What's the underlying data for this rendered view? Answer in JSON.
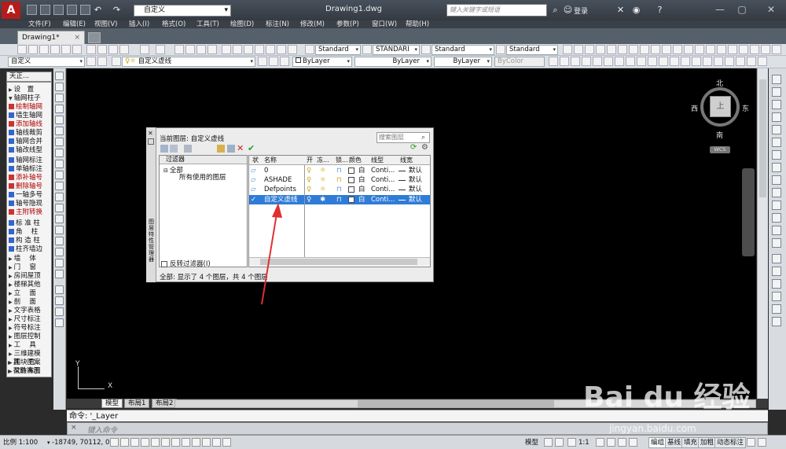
{
  "app": {
    "logo_letter": "A",
    "workspace": "自定义",
    "title": "Drawing1.dwg",
    "search_placeholder": "键入关键字或短语",
    "login": "登录"
  },
  "menu": [
    "文件(F)",
    "编辑(E)",
    "视图(V)",
    "插入(I)",
    "格式(O)",
    "工具(T)",
    "绘图(D)",
    "标注(N)",
    "修改(M)",
    "参数(P)",
    "窗口(W)",
    "帮助(H)"
  ],
  "doc_tab": {
    "label": "Drawing1*",
    "close": "×"
  },
  "toolbar1": {
    "text_style": "Standard",
    "dim_style": "STANDARI",
    "table_style": "Standard",
    "mleader_style": "Standard"
  },
  "toolbar2": {
    "workspace": "自定义",
    "layer": "自定义虚线",
    "color": "ByLayer",
    "linetype": "ByLayer",
    "lineweight": "ByLayer",
    "plotstyle": "ByColor"
  },
  "palette": {
    "header": "天正...",
    "items": [
      {
        "label": "设　置",
        "type": "section"
      },
      {
        "label": "轴网柱子",
        "type": "section"
      },
      {
        "label": "绘制轴网",
        "type": "tool"
      },
      {
        "label": "墙生轴网",
        "type": "tool"
      },
      {
        "label": "添加轴线",
        "type": "tool"
      },
      {
        "label": "轴线裁剪",
        "type": "tool"
      },
      {
        "label": "轴网合并",
        "type": "tool"
      },
      {
        "label": "轴改线型",
        "type": "tool"
      },
      {
        "label": "轴网标注",
        "type": "tool"
      },
      {
        "label": "单轴标注",
        "type": "tool"
      },
      {
        "label": "添补轴号",
        "type": "tool"
      },
      {
        "label": "删除轴号",
        "type": "tool"
      },
      {
        "label": "一轴多号",
        "type": "tool"
      },
      {
        "label": "轴号隐现",
        "type": "tool"
      },
      {
        "label": "主附转换",
        "type": "tool"
      },
      {
        "label": "标 准 柱",
        "type": "tool"
      },
      {
        "label": "角　 柱",
        "type": "tool"
      },
      {
        "label": "构 造 柱",
        "type": "tool"
      },
      {
        "label": "柱齐墙边",
        "type": "tool"
      },
      {
        "label": "墙　 体",
        "type": "section"
      },
      {
        "label": "门　 窗",
        "type": "section"
      },
      {
        "label": "房间屋顶",
        "type": "section"
      },
      {
        "label": "楼梯其他",
        "type": "section"
      },
      {
        "label": "立　 面",
        "type": "section"
      },
      {
        "label": "剖　 面",
        "type": "section"
      },
      {
        "label": "文字表格",
        "type": "section"
      },
      {
        "label": "尺寸标注",
        "type": "section"
      },
      {
        "label": "符号标注",
        "type": "section"
      },
      {
        "label": "图层控制",
        "type": "section"
      },
      {
        "label": "工　 具",
        "type": "section"
      },
      {
        "label": "三维建模",
        "type": "section"
      },
      {
        "label": "图块图案",
        "type": "section"
      },
      {
        "label": "文件布图",
        "type": "section"
      },
      {
        "label": "其　 它",
        "type": "section"
      },
      {
        "label": "帮助演示",
        "type": "section"
      }
    ]
  },
  "viewcube": {
    "north": "北",
    "south": "南",
    "east": "东",
    "west": "西",
    "face": "上",
    "wcs": "WCS"
  },
  "ucs": {
    "x": "X",
    "y": "Y"
  },
  "layout_tabs": [
    "模型",
    "布局1",
    "布局2"
  ],
  "command": {
    "history": "命令: '_Layer",
    "placeholder": "键入命令",
    "close": "×"
  },
  "status": {
    "scale": "比例 1:100",
    "coords": "-18749, 70112, 0",
    "model": "模型",
    "annot_scale": "1:1",
    "buttons": [
      "编组",
      "基线",
      "填充",
      "加粗",
      "动态标注"
    ]
  },
  "layer_dialog": {
    "side_title": "图层特性管理器",
    "current": "当前图层: 自定义虚线",
    "search_placeholder": "搜索图层",
    "filter_header": "过滤器",
    "tree_all": "全部",
    "tree_used": "所有使用的图层",
    "invert_label": "反转过滤器(I)",
    "columns": [
      "状",
      "名称",
      "开",
      "冻...",
      "锁...",
      "颜色",
      "线型",
      "线宽"
    ],
    "layers": [
      {
        "name": "0",
        "color": "白",
        "linetype": "Conti...",
        "lineweight": "默认",
        "selected": false
      },
      {
        "name": "ASHADE",
        "color": "白",
        "linetype": "Conti...",
        "lineweight": "默认",
        "selected": false
      },
      {
        "name": "Defpoints",
        "color": "白",
        "linetype": "Conti...",
        "lineweight": "默认",
        "selected": false
      },
      {
        "name": "自定义虚线",
        "color": "白",
        "linetype": "Conti...",
        "lineweight": "默认",
        "selected": true
      }
    ],
    "status": "全部: 显示了 4 个图层，共 4 个图层"
  },
  "watermark": {
    "brand": "Bai du 经验",
    "url": "jingyan.baidu.com"
  },
  "colors": {
    "accent_red": "#b51c1c",
    "selection": "#2f7cd7",
    "canvas": "#000000",
    "arrow": "#e03030"
  }
}
